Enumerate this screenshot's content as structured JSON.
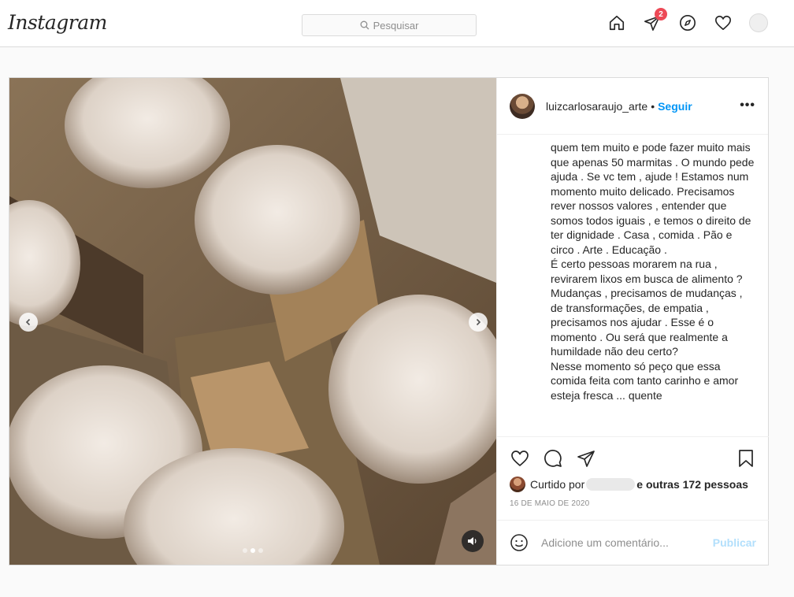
{
  "header": {
    "logo": "Instagram",
    "search_placeholder": "Pesquisar",
    "notifications_count": "2"
  },
  "post": {
    "username": "luizcarlosaraujo_arte",
    "separator": "•",
    "follow_label": "Seguir",
    "more_label": "•••",
    "caption": "quem tem muito e pode fazer muito mais que apenas 50 marmitas . O mundo pede ajuda . Se vc tem , ajude ! Estamos num momento muito delicado. Precisamos rever nossos valores , entender que somos todos iguais , e temos o direito de ter dignidade . Casa , comida . Pão e circo . Arte . Educação .\nÉ certo pessoas morarem na rua , revirarem lixos em busca de alimento ?\nMudanças , precisamos de mudanças , de transformações, de empatia , precisamos nos ajudar . Esse é o momento . Ou será que realmente a humildade não deu certo?\nNesse momento só peço que essa comida feita com tanto carinho e amor esteja fresca ... quente",
    "liked_prefix": "Curtido por",
    "liked_suffix": "e outras 172 pessoas",
    "date": "16 DE MAIO DE 2020",
    "comment_placeholder": "Adicione um comentário...",
    "publish_label": "Publicar",
    "carousel": {
      "total": 3,
      "active": 2
    }
  },
  "colors": {
    "link": "#0095f6",
    "badge": "#ed4956",
    "publish_disabled": "#b2dffc"
  }
}
